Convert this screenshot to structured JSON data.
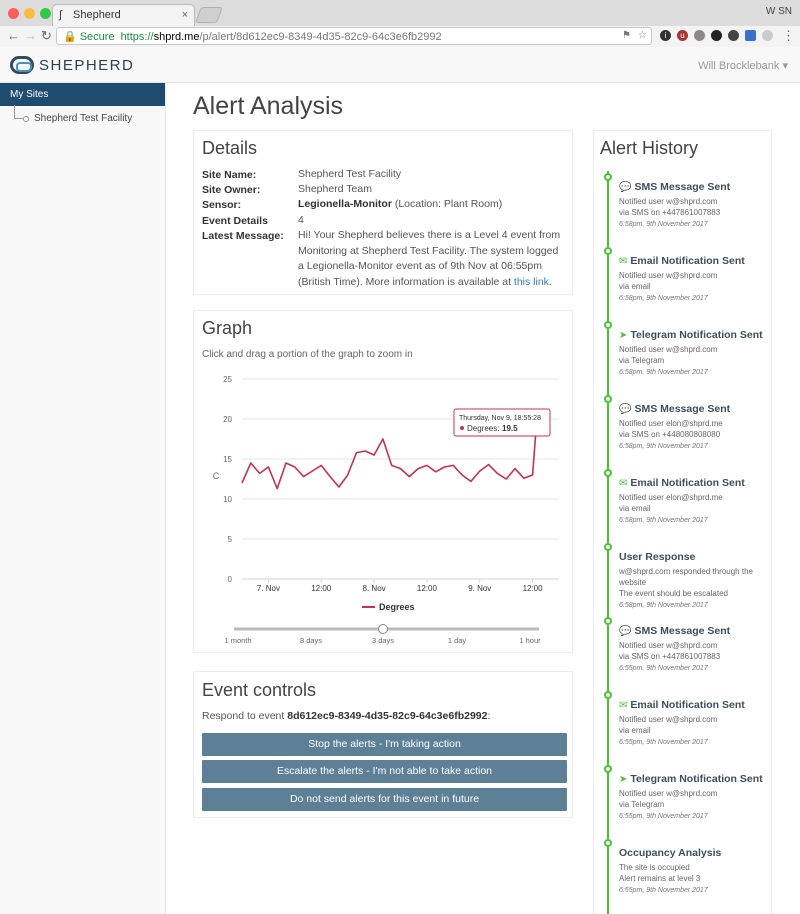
{
  "browser": {
    "tab_title": "Shepherd",
    "profile": "W SN",
    "secure_label": "Secure",
    "url_proto": "https://",
    "url_host": "shprd.me",
    "url_path": "/p/alert/8d612ec9-8349-4d35-82c9-64c3e6fb2992"
  },
  "header": {
    "brand": "SHEPHERD",
    "user": "Will Brocklebank ▾"
  },
  "sidebar": {
    "my_sites": "My Sites",
    "facility": "Shepherd Test Facility"
  },
  "page": {
    "title": "Alert Analysis"
  },
  "details": {
    "heading": "Details",
    "site_name_label": "Site Name:",
    "site_name": "Shepherd Test Facility",
    "site_owner_label": "Site Owner:",
    "site_owner": "Shepherd Team",
    "sensor_label": "Sensor:",
    "sensor_name": "Legionella-Monitor",
    "sensor_location": "(Location: Plant Room)",
    "event_details_label": "Event Details",
    "event_details": "4",
    "latest_message_label": "Latest Message:",
    "latest_message": "Hi! Your Shepherd believes there is a Level 4 event from Monitoring at Shepherd Test Facility. The system logged a Legionella-Monitor event as of 9th Nov at 06:55pm (British Time). More information is available at ",
    "link_text": "this link",
    "after_link": "."
  },
  "graph": {
    "heading": "Graph",
    "hint": "Click and drag a portion of the graph to zoom in"
  },
  "chart_data": {
    "type": "line",
    "ylabel": "C",
    "ylim": [
      0,
      25
    ],
    "yticks": [
      0,
      5,
      10,
      15,
      20,
      25
    ],
    "xticks": [
      "7. Nov",
      "12:00",
      "8. Nov",
      "12:00",
      "9. Nov",
      "12:00"
    ],
    "series": [
      {
        "name": "Degrees",
        "color": "#c0334d",
        "x": [
          0,
          2,
          4,
          6,
          8,
          10,
          12,
          14,
          16,
          18,
          20,
          22,
          24,
          26,
          28,
          30,
          32,
          34,
          36,
          38,
          40,
          42,
          44,
          46,
          48,
          50,
          52,
          54,
          56,
          58,
          60,
          62,
          64,
          66,
          66.9
        ],
        "values": [
          12.0,
          14.5,
          13.2,
          14.0,
          11.3,
          14.5,
          14.0,
          12.8,
          13.5,
          14.2,
          12.8,
          11.5,
          13.0,
          15.8,
          16.0,
          15.5,
          17.5,
          14.2,
          13.8,
          12.8,
          13.8,
          14.2,
          13.4,
          14.0,
          14.2,
          13.0,
          12.2,
          13.5,
          14.3,
          13.2,
          12.5,
          13.8,
          12.6,
          13.0,
          19.5
        ]
      }
    ],
    "tooltip": {
      "date": "Thursday, Nov 9, 18:55:28",
      "label": "Degrees:",
      "value": "19.5"
    },
    "legend": "Degrees",
    "navigator_labels": [
      "1 month",
      "8 days",
      "3 days",
      "1 day",
      "1 hour"
    ],
    "navigator_selected": "3 days"
  },
  "events": {
    "heading": "Event controls",
    "respond_prefix": "Respond to event ",
    "event_id": "8d612ec9-8349-4d35-82c9-64c3e6fb2992",
    "respond_suffix": ":",
    "stop_label": "Stop the alerts - I'm taking action",
    "escalate_label": "Escalate the alerts - I'm not able to take action",
    "mute_label": "Do not send alerts for this event in future"
  },
  "history": {
    "heading": "Alert History",
    "items": [
      {
        "icon": "💬",
        "title": "SMS Message Sent",
        "l1": "Notified user w@shprd.com",
        "l2": "via SMS on +447861007883",
        "time": "6:58pm, 9th November 2017"
      },
      {
        "icon": "✉",
        "title": "Email Notification Sent",
        "l1": "Notified user w@shprd.com",
        "l2": "via email",
        "time": "6:58pm, 9th November 2017"
      },
      {
        "icon": "➤",
        "title": "Telegram Notification Sent",
        "l1": "Notified user w@shprd.com",
        "l2": "via Telegram",
        "time": "6:58pm, 9th November 2017"
      },
      {
        "icon": "💬",
        "title": "SMS Message Sent",
        "l1": "Notified user elon@shprd.me",
        "l2": "via SMS on +448080808080",
        "time": "6:58pm, 9th November 2017"
      },
      {
        "icon": "✉",
        "title": "Email Notification Sent",
        "l1": "Notified user elon@shprd.me",
        "l2": "via email",
        "time": "6:58pm, 9th November 2017"
      },
      {
        "icon": "",
        "title": "User Response",
        "l1": "w@shprd.com responded through the website",
        "l2": "The event should be escalated",
        "time": "6:58pm, 9th November 2017"
      },
      {
        "icon": "💬",
        "title": "SMS Message Sent",
        "l1": "Notified user w@shprd.com",
        "l2": "via SMS on +447861007883",
        "time": "6:55pm, 9th November 2017"
      },
      {
        "icon": "✉",
        "title": "Email Notification Sent",
        "l1": "Notified user w@shprd.com",
        "l2": "via email",
        "time": "6:55pm, 9th November 2017"
      },
      {
        "icon": "➤",
        "title": "Telegram Notification Sent",
        "l1": "Notified user w@shprd.com",
        "l2": "via Telegram",
        "time": "6:55pm, 9th November 2017"
      },
      {
        "icon": "",
        "title": "Occupancy Analysis",
        "l1": "The site is occupied",
        "l2": "Alert remains at level 3",
        "time": "6:55pm, 9th November 2017"
      }
    ]
  }
}
